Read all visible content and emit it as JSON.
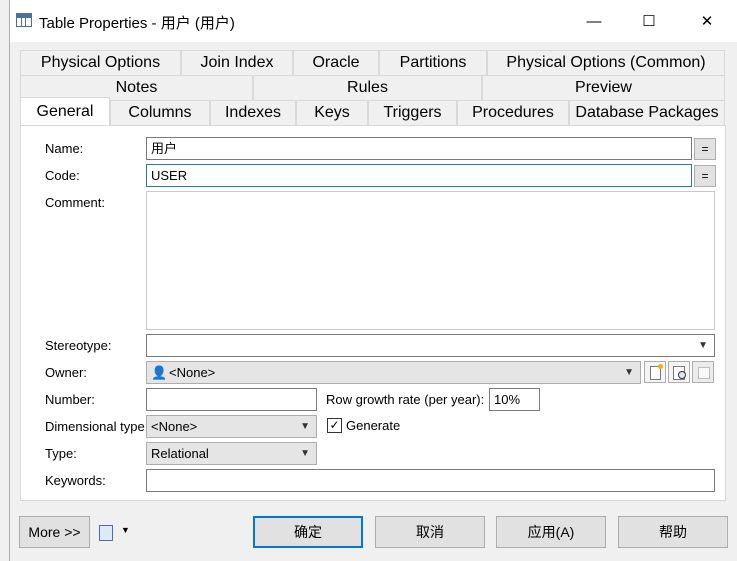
{
  "window": {
    "title": "Table Properties - 用户 (用户)",
    "minimize_glyph": "—",
    "maximize_glyph": "☐",
    "close_glyph": "✕"
  },
  "tabs": {
    "row1": [
      "Physical Options",
      "Join Index",
      "Oracle",
      "Partitions",
      "Physical Options (Common)"
    ],
    "row2": [
      "Notes",
      "Rules",
      "Preview"
    ],
    "row3": [
      "General",
      "Columns",
      "Indexes",
      "Keys",
      "Triggers",
      "Procedures",
      "Database Packages"
    ],
    "active": "General"
  },
  "form": {
    "name_label": "Name:",
    "name_value": "用户",
    "code_label": "Code:",
    "code_value": "USER",
    "eq_glyph": "=",
    "comment_label": "Comment:",
    "comment_value": "",
    "stereotype_label": "Stereotype:",
    "stereotype_value": "",
    "owner_label": "Owner:",
    "owner_value": "<None>",
    "number_label": "Number:",
    "number_value": "",
    "row_growth_label": "Row growth rate (per year):",
    "row_growth_value": "10%",
    "dimensional_label": "Dimensional type:",
    "dimensional_value": "<None>",
    "generate_label": "Generate",
    "generate_checked": true,
    "type_label": "Type:",
    "type_value": "Relational",
    "keywords_label": "Keywords:",
    "keywords_value": ""
  },
  "footer": {
    "more_label": "More >>",
    "ok_label": "确定",
    "cancel_label": "取消",
    "apply_label": "应用(A)",
    "help_label": "帮助"
  },
  "colors": {
    "accent": "#0078d7",
    "focus_border": "#2a7d8c"
  }
}
